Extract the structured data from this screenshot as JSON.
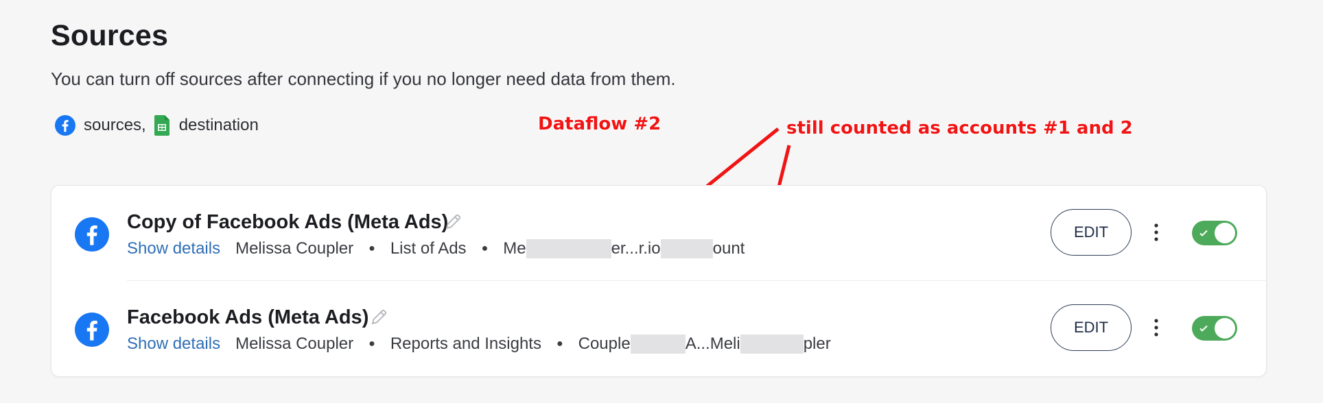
{
  "header": {
    "title": "Sources",
    "subtitle": "You can turn off sources after connecting if you no longer need data from them."
  },
  "legend": {
    "sources_label": "sources,",
    "destination_label": "destination",
    "source_icon": "facebook-icon",
    "destination_icon": "google-sheets-icon"
  },
  "annotations": {
    "dataflow": "Dataflow #2",
    "counted": "still counted as accounts #1 and 2",
    "color": "#f01414"
  },
  "sources": [
    {
      "name": "Copy of Facebook Ads (Meta Ads)",
      "show_details": "Show details",
      "owner": "Melissa Coupler",
      "report": "List of Ads",
      "account_a": "Me",
      "account_b": "er...r.io",
      "account_c": "ount",
      "edit_label": "EDIT",
      "enabled": true
    },
    {
      "name": "Facebook Ads (Meta Ads)",
      "show_details": "Show details",
      "owner": "Melissa Coupler",
      "report": "Reports and Insights",
      "account_a": "Couple",
      "account_b": "A...Meli",
      "account_c": "pler",
      "edit_label": "EDIT",
      "enabled": true
    }
  ],
  "colors": {
    "facebook": "#1877f2",
    "link": "#2f6fb6",
    "toggle_on": "#4caa5a",
    "sheets": "#34a853"
  }
}
